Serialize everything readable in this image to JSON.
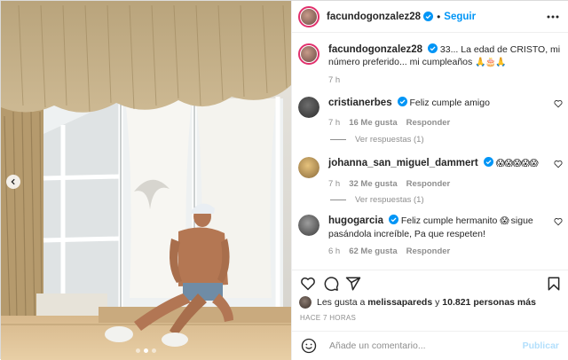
{
  "post": {
    "username": "facundogonzalez28",
    "follow_label": "Seguir",
    "separator": "•",
    "caption": "33... La edad de CRISTO, mi número preferido... mi cumpleaños",
    "caption_emoji": "🙏🎂🙏",
    "caption_age": "7 h"
  },
  "comments": [
    {
      "username": "cristianerbes",
      "text": "Feliz cumple amigo",
      "emoji": "",
      "age": "7 h",
      "likes": "16 Me gusta",
      "reply_label": "Responder",
      "view_replies": "Ver respuestas (1)"
    },
    {
      "username": "johanna_san_miguel_dammert",
      "text": "",
      "emoji": "😱😱😱😱😱",
      "age": "7 h",
      "likes": "32 Me gusta",
      "reply_label": "Responder",
      "view_replies": "Ver respuestas (1)"
    },
    {
      "username": "hugogarcia",
      "text": "Feliz cumple hermanito",
      "emoji": "😱",
      "text2": "sigue pasándola increíble, Pa que respeten!",
      "age": "6 h",
      "likes": "62 Me gusta",
      "reply_label": "Responder"
    }
  ],
  "likes": {
    "prefix": "Les gusta a",
    "user": "melissapareds",
    "middle": "y",
    "count": "10.821 personas más"
  },
  "time_ago": "HACE 7 HORAS",
  "composer": {
    "placeholder": "Añade un comentario...",
    "publish_label": "Publicar"
  },
  "colors": {
    "link": "#0095f6",
    "publish_disabled": "#b2dffc",
    "secondary_text": "#8e8e8e"
  },
  "icons": [
    "heart-icon",
    "comment-icon",
    "share-icon",
    "bookmark-icon",
    "emoji-icon",
    "more-icon",
    "verified-icon",
    "chevron-left-icon"
  ]
}
